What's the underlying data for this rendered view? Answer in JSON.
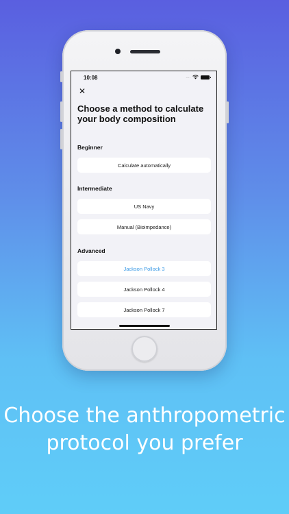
{
  "status_bar": {
    "time": "10:08",
    "signal": "....",
    "wifi_icon": "wifi-icon",
    "battery_icon": "battery-icon"
  },
  "nav": {
    "close_icon": "close-icon",
    "close_glyph": "✕"
  },
  "title": "Choose a method to calculate your body composition",
  "sections": [
    {
      "label": "Beginner",
      "options": [
        {
          "label": "Calculate automatically",
          "selected": false
        }
      ]
    },
    {
      "label": "Intermediate",
      "options": [
        {
          "label": "US Navy",
          "selected": false
        },
        {
          "label": "Manual (Bioimpedance)",
          "selected": false
        }
      ]
    },
    {
      "label": "Advanced",
      "options": [
        {
          "label": "Jackson Pollock 3",
          "selected": true
        },
        {
          "label": "Jackson Pollock 4",
          "selected": false
        },
        {
          "label": "Jackson Pollock 7",
          "selected": false
        }
      ]
    }
  ],
  "caption": "Choose the anthropometric protocol you prefer",
  "colors": {
    "selected": "#3a9ae6",
    "screen_bg": "#f2f2f7",
    "gradient_top": "#5a5fe0",
    "gradient_bottom": "#5fcdf8"
  }
}
